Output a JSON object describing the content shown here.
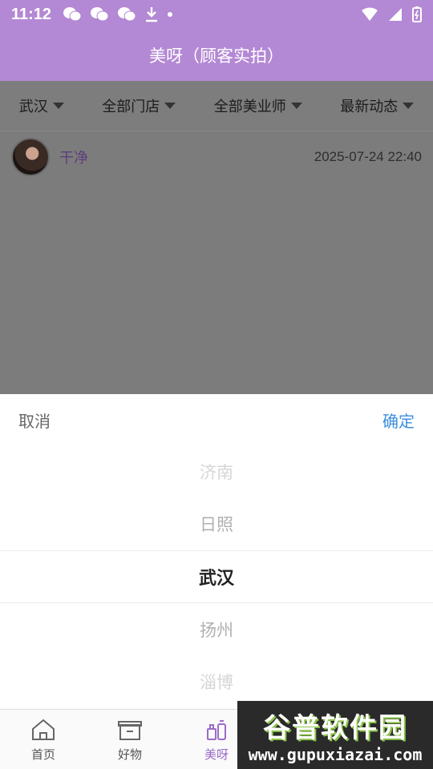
{
  "status_bar": {
    "time": "11:12"
  },
  "header": {
    "title": "美呀（顾客实拍）"
  },
  "filters": [
    {
      "label": "武汉"
    },
    {
      "label": "全部门店"
    },
    {
      "label": "全部美业师"
    },
    {
      "label": "最新动态"
    }
  ],
  "post": {
    "name": "干净",
    "time": "2025-07-24 22:40"
  },
  "picker": {
    "cancel": "取消",
    "confirm": "确定",
    "options": [
      "济南",
      "日照",
      "武汉",
      "扬州",
      "淄博"
    ],
    "selected": "武汉"
  },
  "tabs": [
    {
      "label": "首页",
      "icon": "home-icon"
    },
    {
      "label": "好物",
      "icon": "gift-box-icon"
    },
    {
      "label": "美呀",
      "icon": "cosmetics-icon",
      "active": true
    }
  ],
  "watermark": {
    "title": "谷普软件园",
    "url": "www.gupuxiazai.com"
  },
  "colors": {
    "accent": "#b388d4",
    "confirm": "#3c8fe0",
    "active_tab": "#9b6cc7"
  }
}
